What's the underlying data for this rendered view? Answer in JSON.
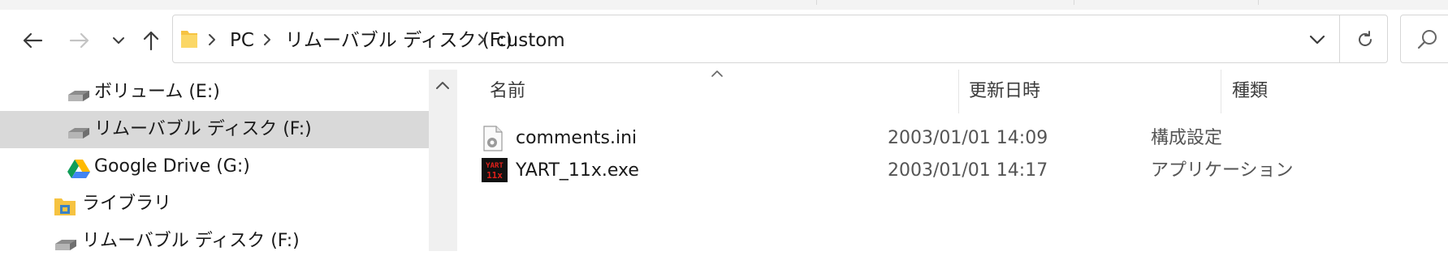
{
  "toolbar": {
    "back_icon": "arrow-left-icon",
    "forward_icon": "arrow-right-icon",
    "recent_icon": "chevron-down-icon",
    "up_icon": "arrow-up-icon"
  },
  "address": {
    "crumbs": [
      "PC",
      "リムーバブル ディスク (F:)",
      "custom"
    ]
  },
  "nav_pane": {
    "items": [
      {
        "label": "ボリューム (E:)",
        "icon": "drive-icon"
      },
      {
        "label": "リムーバブル ディスク (F:)",
        "icon": "removable-drive-icon",
        "selected": true
      },
      {
        "label": "Google Drive (G:)",
        "icon": "google-drive-icon"
      },
      {
        "label": "ライブラリ",
        "icon": "library-icon"
      },
      {
        "label": "リムーバブル ディスク (F:)",
        "icon": "removable-drive-icon"
      }
    ]
  },
  "columns": {
    "name": "名前",
    "date": "更新日時",
    "type": "種類"
  },
  "files": [
    {
      "name": "comments.ini",
      "date": "2003/01/01 14:09",
      "type": "構成設定",
      "icon": "settings-file-icon"
    },
    {
      "name": "YART_11x.exe",
      "date": "2003/01/01 14:17",
      "type": "アプリケーション",
      "icon": "yart-app-icon",
      "icon_text": [
        "YART",
        "11x"
      ]
    }
  ],
  "colors": {
    "selected_bg": "#d9d9d9",
    "folder_yellow": "#f6c341",
    "app_icon_bg": "#111111",
    "app_icon_text": "#e0201a"
  }
}
